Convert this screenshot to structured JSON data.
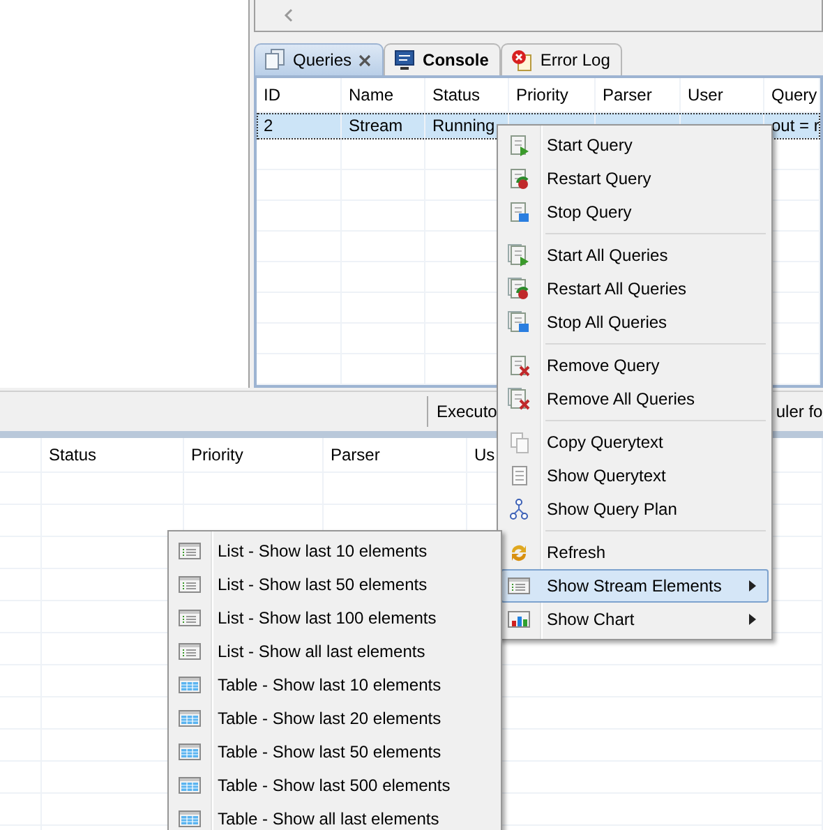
{
  "queries_view": {
    "tabs": [
      {
        "label": "Queries",
        "selected": true,
        "closable": true,
        "bold": false
      },
      {
        "label": "Console",
        "selected": false,
        "closable": false,
        "bold": true
      },
      {
        "label": "Error Log",
        "selected": false,
        "closable": false,
        "bold": false
      }
    ],
    "table": {
      "columns": [
        "ID",
        "Name",
        "Status",
        "Priority",
        "Parser",
        "User",
        "Query"
      ],
      "rows": [
        {
          "selected": true,
          "cells": [
            "2",
            "Stream",
            "Running",
            null,
            null,
            null,
            "out = r"
          ]
        }
      ]
    }
  },
  "status_bar": {
    "items": [
      "Executo",
      "uler fo"
    ]
  },
  "bottom_table": {
    "columns": [
      "Status",
      "Priority",
      "Parser",
      "Us"
    ]
  },
  "context_menu": {
    "items": [
      {
        "kind": "item",
        "label": "Start Query",
        "selected": false,
        "submenu": false
      },
      {
        "kind": "item",
        "label": "Restart Query",
        "selected": false,
        "submenu": false
      },
      {
        "kind": "item",
        "label": "Stop Query",
        "selected": false,
        "submenu": false
      },
      {
        "kind": "separator"
      },
      {
        "kind": "item",
        "label": "Start All Queries",
        "selected": false,
        "submenu": false
      },
      {
        "kind": "item",
        "label": "Restart All Queries",
        "selected": false,
        "submenu": false
      },
      {
        "kind": "item",
        "label": "Stop All Queries",
        "selected": false,
        "submenu": false
      },
      {
        "kind": "separator"
      },
      {
        "kind": "item",
        "label": "Remove Query",
        "selected": false,
        "submenu": false
      },
      {
        "kind": "item",
        "label": "Remove All Queries",
        "selected": false,
        "submenu": false
      },
      {
        "kind": "separator"
      },
      {
        "kind": "item",
        "label": "Copy Querytext",
        "selected": false,
        "submenu": false
      },
      {
        "kind": "item",
        "label": "Show Querytext",
        "selected": false,
        "submenu": false
      },
      {
        "kind": "item",
        "label": "Show Query Plan",
        "selected": false,
        "submenu": false
      },
      {
        "kind": "separator"
      },
      {
        "kind": "item",
        "label": "Refresh",
        "selected": false,
        "submenu": false
      },
      {
        "kind": "item",
        "label": "Show Stream Elements",
        "selected": true,
        "submenu": true
      },
      {
        "kind": "item",
        "label": "Show Chart",
        "selected": false,
        "submenu": true
      }
    ]
  },
  "submenu": {
    "items": [
      {
        "kind": "list",
        "label": "List - Show last 10 elements"
      },
      {
        "kind": "list",
        "label": "List - Show last 50 elements"
      },
      {
        "kind": "list",
        "label": "List - Show last 100 elements"
      },
      {
        "kind": "list",
        "label": "List - Show all last elements"
      },
      {
        "kind": "table",
        "label": "Table - Show last 10 elements"
      },
      {
        "kind": "table",
        "label": "Table - Show last 20 elements"
      },
      {
        "kind": "table",
        "label": "Table - Show last 50 elements"
      },
      {
        "kind": "table",
        "label": "Table - Show last 500 elements"
      },
      {
        "kind": "table",
        "label": "Table - Show all last elements"
      }
    ]
  }
}
